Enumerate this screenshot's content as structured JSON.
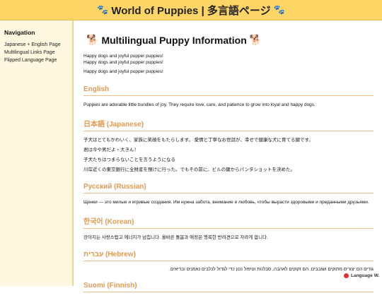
{
  "header": {
    "title": "World of Puppies | 多言語ページ",
    "left_icon": "🐾",
    "right_icon": "🐾"
  },
  "sidebar": {
    "heading": "Navigation",
    "items": [
      {
        "label": "Japanese + English Page"
      },
      {
        "label": "Multilingual Links Page"
      },
      {
        "label": "Flipped Language Page"
      }
    ]
  },
  "main": {
    "title": "Multilingual Puppy Information",
    "title_icon": "🐕",
    "intro": [
      "Happy dogs and joyful pupper puppies!",
      "Happy dogs and joyful pupper puppies!",
      "Happy dogs and joyful pupper puppies!"
    ],
    "sections": {
      "english": {
        "heading": "English",
        "text": "Puppies are adorable little bundles of joy. They require love, care, and patience to grow into loyal and happy dogs."
      },
      "japanese": {
        "heading": "日本語 (Japanese)",
        "lines": [
          "子犬はとてもかわいく、家族に笑顔をもたらします。 愛情と丁寧なお世話が、幸せで健康な犬に育てる鍵です。",
          "君は今や男だよ・大きん！",
          "子犬たちはつまらないことを言うようになる",
          "川岸近くの東京銀行に全財産を預けに行った。でもその前に、ビルの鍵からパンタショットを決めた。"
        ]
      },
      "russian": {
        "heading": "Русский (Russian)",
        "text": "Щенки — это милые и игривые создания. Им нужна забота, внимание и любовь, чтобы вырасти здоровыми и преданными друзьями."
      },
      "korean": {
        "heading": "한국어 (Korean)",
        "text": "강아지는 사랑스럽고 에너지가 넘칩니다. 올바른 돌봄과 애정은 행복한 반려견으로 자라게 합니다."
      },
      "hebrew": {
        "heading": "עברית (Hebrew)",
        "text": "גורים הם יצורים מתוקים ושובבים. הם זקוקים לאהבה, סבלנות וטיפול נכון כדי לגדול לכלבים נאמנים ובריאים."
      },
      "finnish": {
        "heading": "Suomi (Finnish)"
      }
    }
  },
  "badge": {
    "label": "Language",
    "suffix": "W."
  },
  "colors": {
    "header_bg": "#ffd666",
    "sidebar_bg": "#fff7df",
    "section_heading": "#e59a52"
  }
}
